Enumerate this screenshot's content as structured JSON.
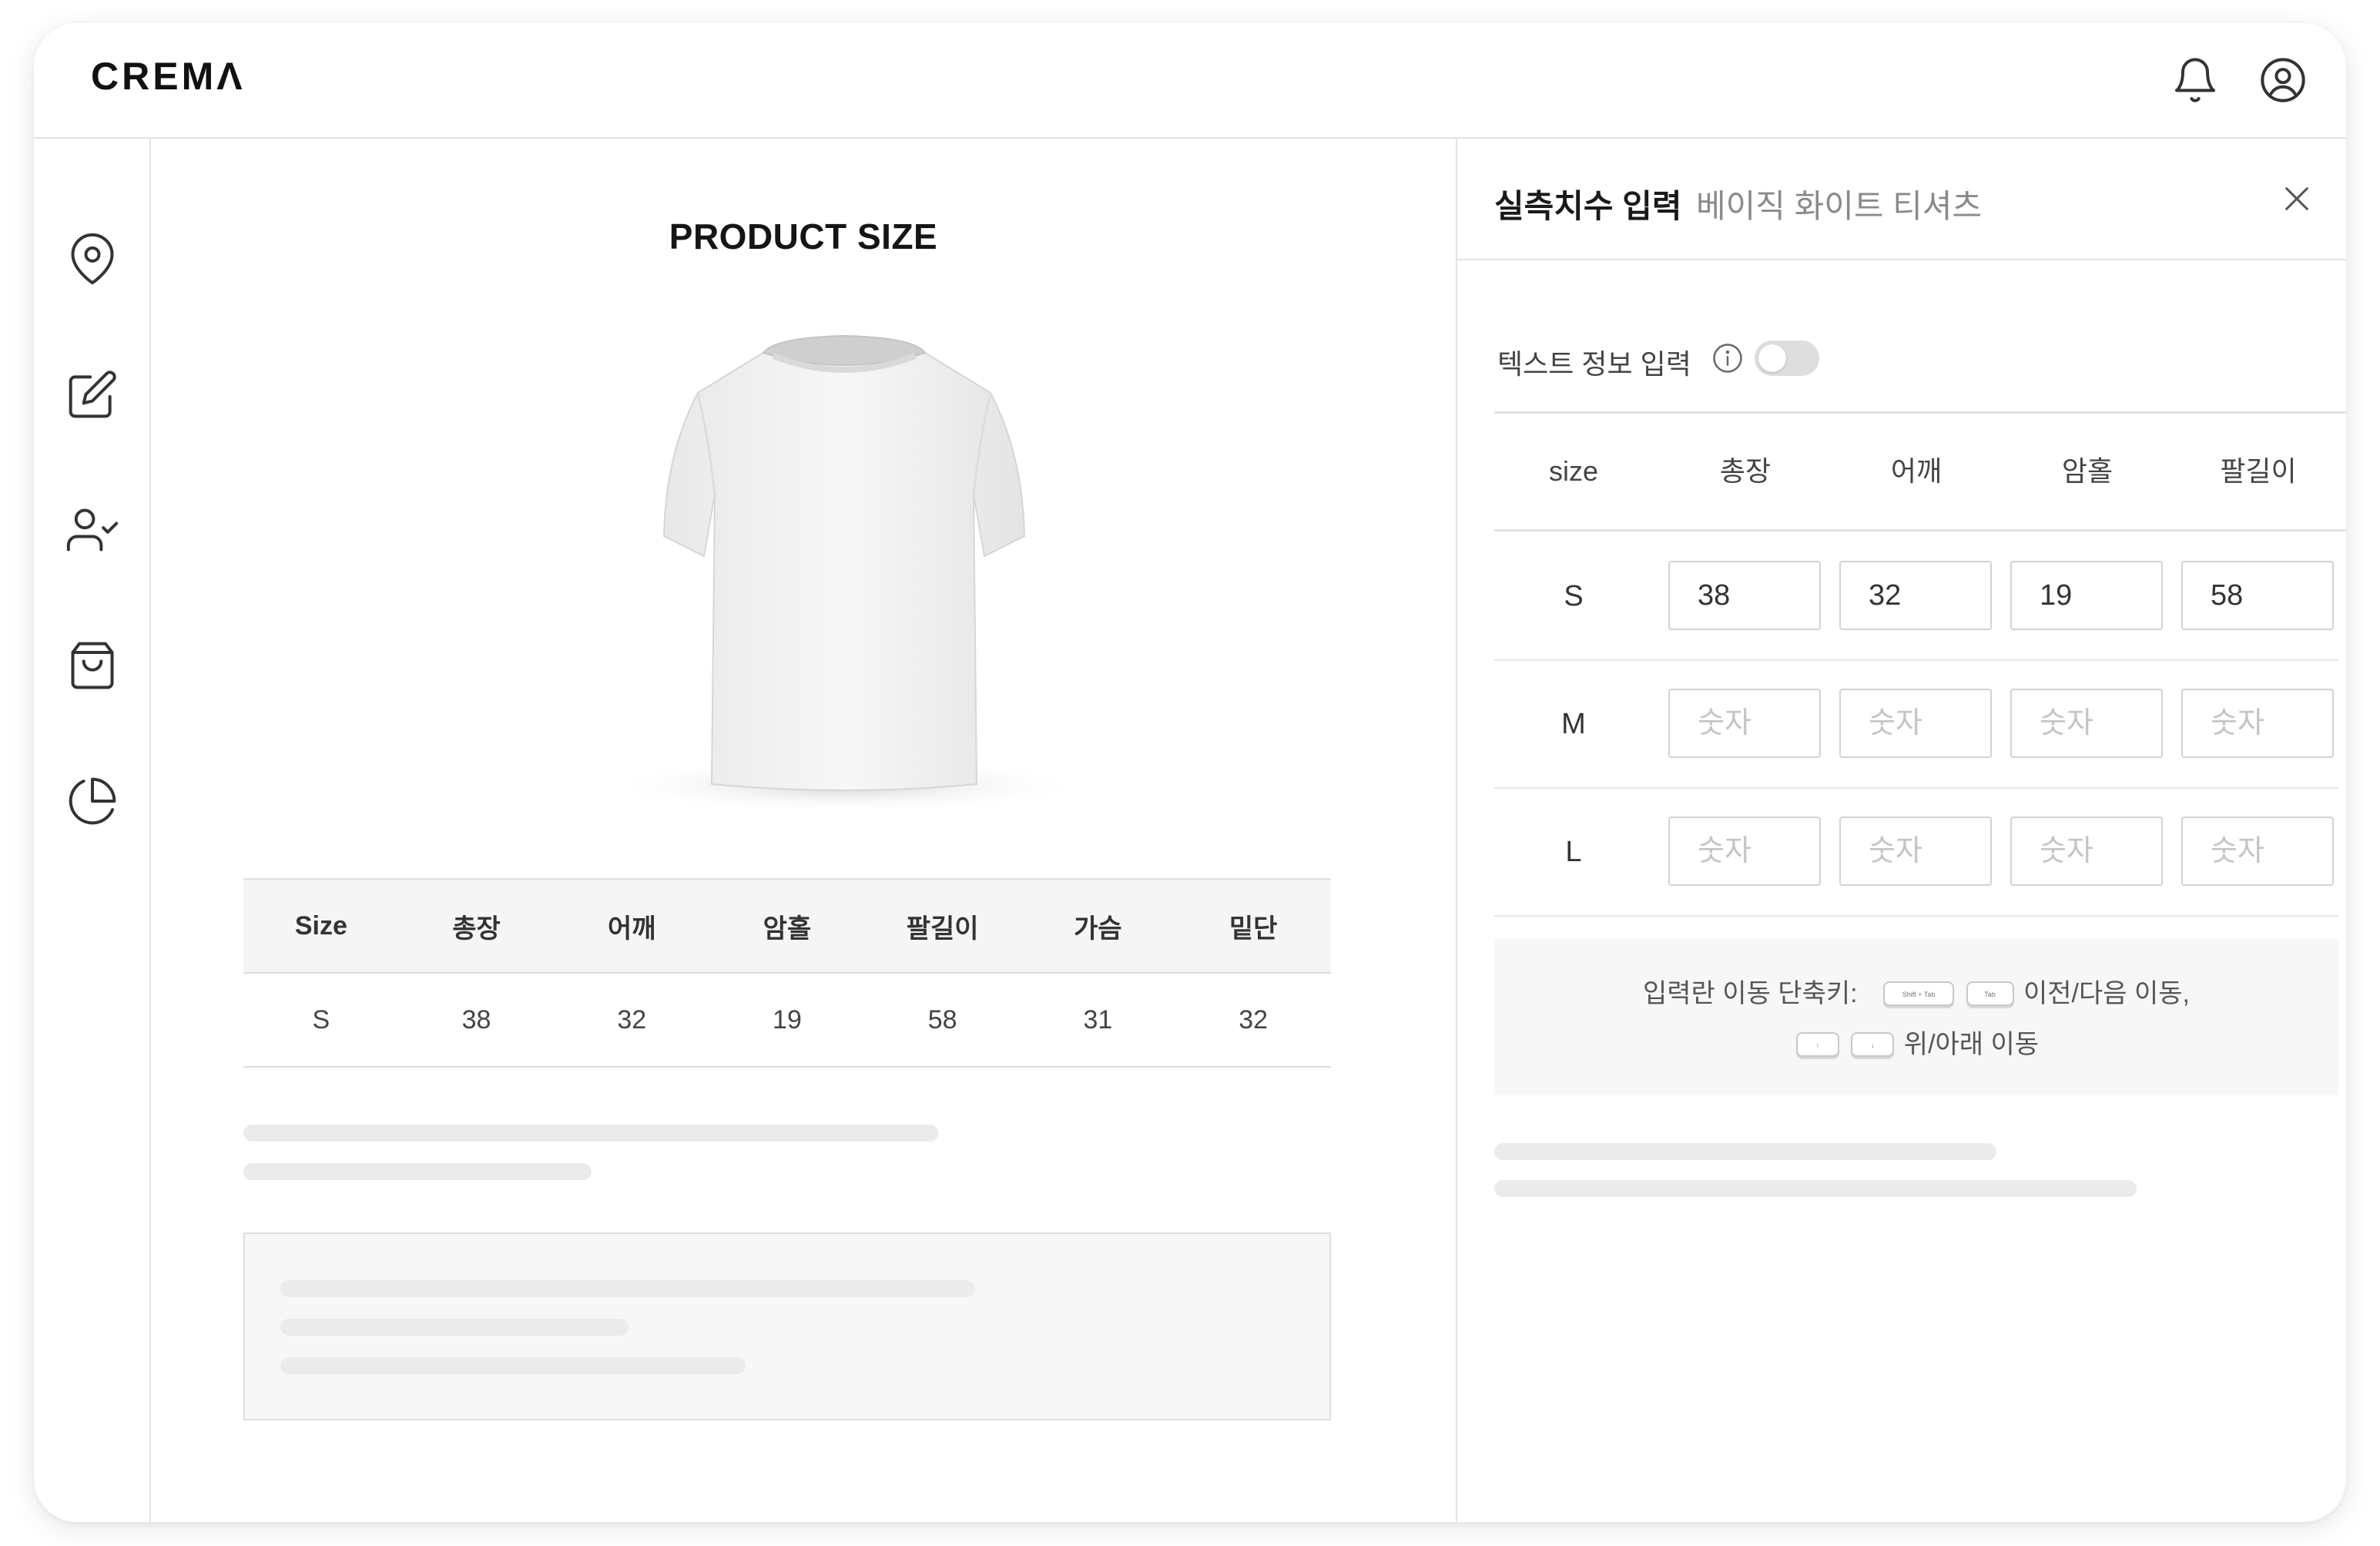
{
  "app": {
    "logo": "CREMΛ"
  },
  "header": {
    "icons": [
      "bell-icon",
      "user-circle-icon"
    ]
  },
  "sidebar": {
    "items": [
      {
        "icon": "map-pin-icon"
      },
      {
        "icon": "edit-icon"
      },
      {
        "icon": "user-check-icon"
      },
      {
        "icon": "shopping-bag-icon"
      },
      {
        "icon": "pie-chart-icon"
      }
    ]
  },
  "product": {
    "title": "PRODUCT SIZE",
    "image": "white-tshirt",
    "table": {
      "headers": [
        "Size",
        "총장",
        "어깨",
        "암홀",
        "팔길이",
        "가슴",
        "밑단"
      ],
      "rows": [
        [
          "S",
          "38",
          "32",
          "19",
          "58",
          "31",
          "32"
        ]
      ]
    }
  },
  "panel": {
    "title": "실측치수 입력",
    "subtitle": "베이직 화이트 티셔츠",
    "toggle": {
      "label": "텍스트 정보 입력",
      "on": false
    },
    "columns": [
      "size",
      "총장",
      "어깨",
      "암홀",
      "팔길이"
    ],
    "placeholder": "숫자",
    "rows": [
      {
        "size": "S",
        "values": [
          "38",
          "32",
          "19",
          "58"
        ]
      },
      {
        "size": "M",
        "values": [
          "",
          "",
          "",
          ""
        ]
      },
      {
        "size": "L",
        "values": [
          "",
          "",
          "",
          ""
        ]
      }
    ],
    "shortcut": {
      "prefix": "입력란 이동 단축키:",
      "key_shift_tab": "Shift + Tab",
      "key_tab": "Tab",
      "prev_next": "이전/다음 이동,",
      "key_up": "↑",
      "key_down": "↓",
      "up_down": "위/아래 이동"
    }
  },
  "colors": {
    "border": "#e3e3e3",
    "skeleton": "#ebebeb",
    "header_bg": "#f5f5f6",
    "toggle_off": "#dedede"
  }
}
